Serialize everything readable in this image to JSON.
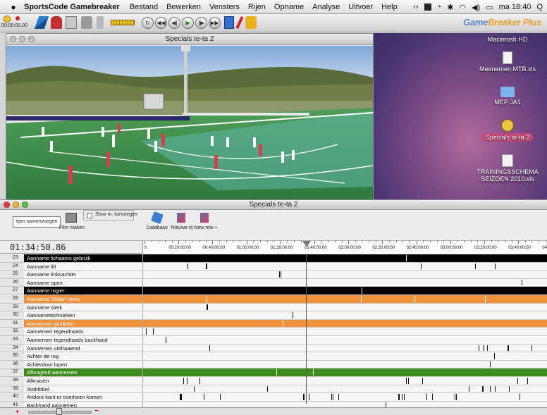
{
  "menubar": {
    "app_name": "SportsCode Gamebreaker",
    "menus": [
      "Bestand",
      "Bewerken",
      "Vensters",
      "Rijen",
      "Opname",
      "Analyse",
      "Uitvoer",
      "Help"
    ],
    "clock": "ma 18:40"
  },
  "toolbar": {
    "timecode": "00:00:00.00",
    "brand": "Game",
    "brand_accent": "Breaker Plus"
  },
  "video_window": {
    "title": "Specials te-ta 2"
  },
  "desktop": {
    "items": [
      {
        "label": "Macintosh HD",
        "icon": "hard-drive-icon",
        "selected": false
      },
      {
        "label": "Meenemen MTB.xls",
        "icon": "document-icon",
        "selected": false
      },
      {
        "label": "MEP JA1",
        "icon": "folder-icon",
        "selected": false
      },
      {
        "label": "Specials te-ta 2",
        "icon": "movie-package-icon",
        "selected": true
      },
      {
        "label": "TRAININGSSCHEMA SEIZOEN   2010.xls",
        "icon": "spreadsheet-icon",
        "selected": false
      }
    ]
  },
  "timeline_window": {
    "title": "Specials te-ta 2",
    "buttons": {
      "merge_rows": "rijen samenvoegen",
      "make_movie": "Film maken",
      "slowmo": "Slow-m. toevoegen",
      "database": "Database",
      "new_row_nl": "Nieuwe rij",
      "new_row_en": "New row +"
    },
    "timecode": "01:34:50.86",
    "ruler_labels": [
      "0",
      "00:20:00:00",
      "00:40:00:00",
      "01:00:00:00",
      "01:20:00:00",
      "01:40:00:00",
      "02:00:00:00",
      "02:20:00:00",
      "02:40:00:00",
      "03:00:00:00",
      "03:20:00:00",
      "03:40:00:00",
      "04"
    ],
    "playhead_fraction": 0.405,
    "rows": [
      {
        "num": "23",
        "name": "Aanname lichaams gebruik",
        "style": "dark",
        "marks": [
          0.65
        ]
      },
      {
        "num": "24",
        "name": "Aanname lift",
        "style": "plain",
        "marks": [
          0.11,
          0.155,
          0.157,
          0.687,
          0.82,
          0.87
        ]
      },
      {
        "num": "25",
        "name": "Aanname linksachter",
        "style": "plain",
        "marks": [
          0.336,
          0.34
        ]
      },
      {
        "num": "26",
        "name": "Aanname open",
        "style": "plain",
        "marks": [
          0.935
        ]
      },
      {
        "num": "27",
        "name": "Aanname rogier",
        "style": "dark",
        "marks": [
          0.54
        ]
      },
      {
        "num": "28",
        "name": "Aanname Stefan Veen",
        "style": "orange",
        "marks": [
          0.157,
          0.538,
          0.67,
          0.845
        ]
      },
      {
        "num": "29",
        "name": "Aanname sterk",
        "style": "plain",
        "marks": [
          0.157,
          0.159
        ]
      },
      {
        "num": "30",
        "name": "Aannametechnieken",
        "style": "plain",
        "marks": [
          0.37
        ]
      },
      {
        "num": "31",
        "name": "Aannemen gesloten",
        "style": "orange",
        "marks": [
          0.345
        ]
      },
      {
        "num": "32",
        "name": "Aannemen tegendraads",
        "style": "plain",
        "marks": [
          0.007,
          0.025
        ]
      },
      {
        "num": "33",
        "name": "Aannemen tegendraads backhand",
        "style": "plain",
        "marks": [
          0.055
        ]
      },
      {
        "num": "34",
        "name": "Aannemen uitdraaiend",
        "style": "plain",
        "marks": [
          0.163,
          0.83,
          0.842,
          0.85,
          0.9,
          0.902,
          0.96
        ]
      },
      {
        "num": "35",
        "name": "Achter de rug",
        "style": "plain",
        "marks": [
          0.868
        ]
      },
      {
        "num": "36",
        "name": "Achterdoor lopen",
        "style": "plain",
        "marks": [
          0.857
        ]
      },
      {
        "num": "37",
        "name": "Afbuigend aannemen",
        "style": "green",
        "marks": [
          0.33,
          0.42
        ]
      },
      {
        "num": "38",
        "name": "Afkruisen",
        "style": "plain",
        "marks": [
          0.1,
          0.108,
          0.14,
          0.65,
          0.655,
          0.69,
          0.925,
          0.95
        ]
      },
      {
        "num": "39",
        "name": "Airdribbel",
        "style": "plain",
        "marks": [
          0.125,
          0.307,
          0.805,
          0.838,
          0.84,
          0.858,
          0.87,
          0.905
        ]
      },
      {
        "num": "40",
        "name": "Andere kant er overheen komen",
        "style": "plain",
        "marks": [
          0.09,
          0.092,
          0.094,
          0.15,
          0.19,
          0.395,
          0.398,
          0.41,
          0.465,
          0.468,
          0.483,
          0.63,
          0.633,
          0.64,
          0.645,
          0.7,
          0.715,
          0.77,
          0.773,
          0.93
        ]
      },
      {
        "num": "41",
        "name": "Backhand aannemen",
        "style": "plain",
        "marks": [
          0.6
        ]
      }
    ]
  }
}
